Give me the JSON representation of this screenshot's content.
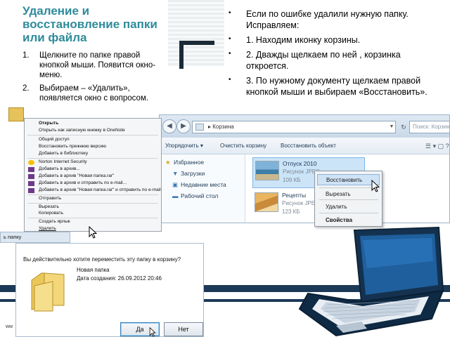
{
  "slide": {
    "title": "Удаление и восстановление папки или файла",
    "left_steps": [
      {
        "num": "1.",
        "text": "Щелкните по папке правой кнопкой мыши. Появится окно-меню."
      },
      {
        "num": "2.",
        "text": "Выбираем – «Удалить», появляется окно с вопросом."
      }
    ],
    "right_bullets": [
      "Если по ошибке удалили нужную папку. Исправляем:",
      "1. Находим иконку корзины.",
      "2. Дважды щелкаем по ней , корзинка откроется.",
      "3. По нужному документу щелкаем правой кнопкой мыши и выбираем «Восстановить»."
    ],
    "bullet_glyph": "•",
    "title_color": "#2e8b9a"
  },
  "explorer": {
    "address": "Корзина",
    "address_prefix": "▸",
    "search_placeholder": "Поиск: Корзина",
    "toolbar": [
      "Упорядочить ▾",
      "Очистить корзину",
      "Восстановить объект"
    ],
    "toolbar_icons": "☰ ▾ ▢ ?",
    "nav": [
      {
        "icon": "★",
        "label": "Избранное"
      },
      {
        "icon": "▼",
        "label": "Загрузки"
      },
      {
        "icon": "▣",
        "label": "Недавние места"
      },
      {
        "icon": "▬",
        "label": "Рабочий стол"
      }
    ],
    "files": [
      {
        "name": "Отпуск 2010",
        "type": "Рисунок JPEG",
        "size": "109 КБ",
        "thumb": "sea"
      },
      {
        "name": "Рецепты",
        "type": "Рисунок JPEG",
        "size": "123 КБ",
        "thumb": "sand"
      }
    ],
    "context_menu": [
      "Восстановить",
      "Вырезать",
      "Удалить",
      "Свойства"
    ]
  },
  "folder_menu": {
    "items": [
      "Открыть",
      "Открыть как записную книжку в OneNote",
      "Общий доступ",
      "Восстановить прежнюю версию",
      "Добавить в библиотеку",
      "Norton Internet Security",
      "Добавить в архив...",
      "Добавить в архив \"Новая папка.rar\"",
      "Добавить в архив и отправить по e-mail...",
      "Добавить в архив \"Новая папка.rar\" и отправить по e-mail",
      "Отправить",
      "Вырезать",
      "Копировать",
      "Создать ярлык",
      "Удалить"
    ]
  },
  "dialog": {
    "caption": "ь папку",
    "question": "Вы действительно хотите переместить эту папку в корзину?",
    "folder_name": "Новая папка",
    "created": "Дата создания: 26.09.2012 20:46",
    "yes": "Да",
    "no": "Нет"
  },
  "footer_stub": "ww"
}
